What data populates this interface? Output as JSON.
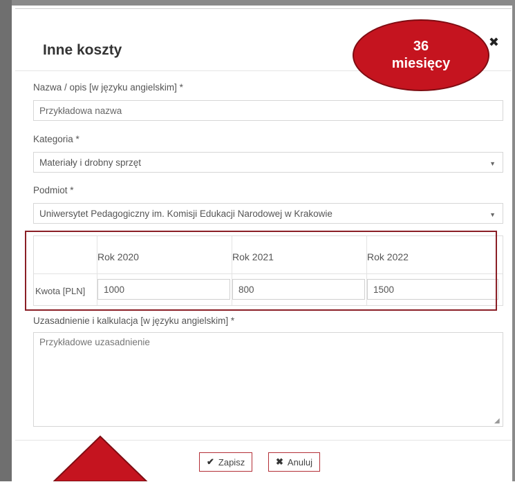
{
  "modal": {
    "title": "Inne koszty",
    "close_icon": "close-icon"
  },
  "badge": {
    "line1": "36",
    "line2": "miesięcy"
  },
  "form": {
    "name_label": "Nazwa / opis [w języku angielskim] *",
    "name_placeholder": "Przykładowa nazwa",
    "category_label": "Kategoria *",
    "category_value": "Materiały i drobny sprzęt",
    "entity_label": "Podmiot *",
    "entity_value": "Uniwersytet Pedagogiczny im. Komisji Edukacji Narodowej w Krakowie",
    "amounts": {
      "row_label": "Kwota [PLN]",
      "years": [
        "Rok 2020",
        "Rok 2021",
        "Rok 2022"
      ],
      "values": [
        "1000",
        "800",
        "1500"
      ]
    },
    "justification_label": "Uzasadnienie i kalkulacja [w języku angielskim] *",
    "justification_placeholder": "Przykładowe uzasadnienie"
  },
  "footer": {
    "save_label": "Zapisz",
    "cancel_label": "Anuluj"
  },
  "colors": {
    "accent_red": "#c5141f",
    "highlight_border": "#8a1e25"
  }
}
